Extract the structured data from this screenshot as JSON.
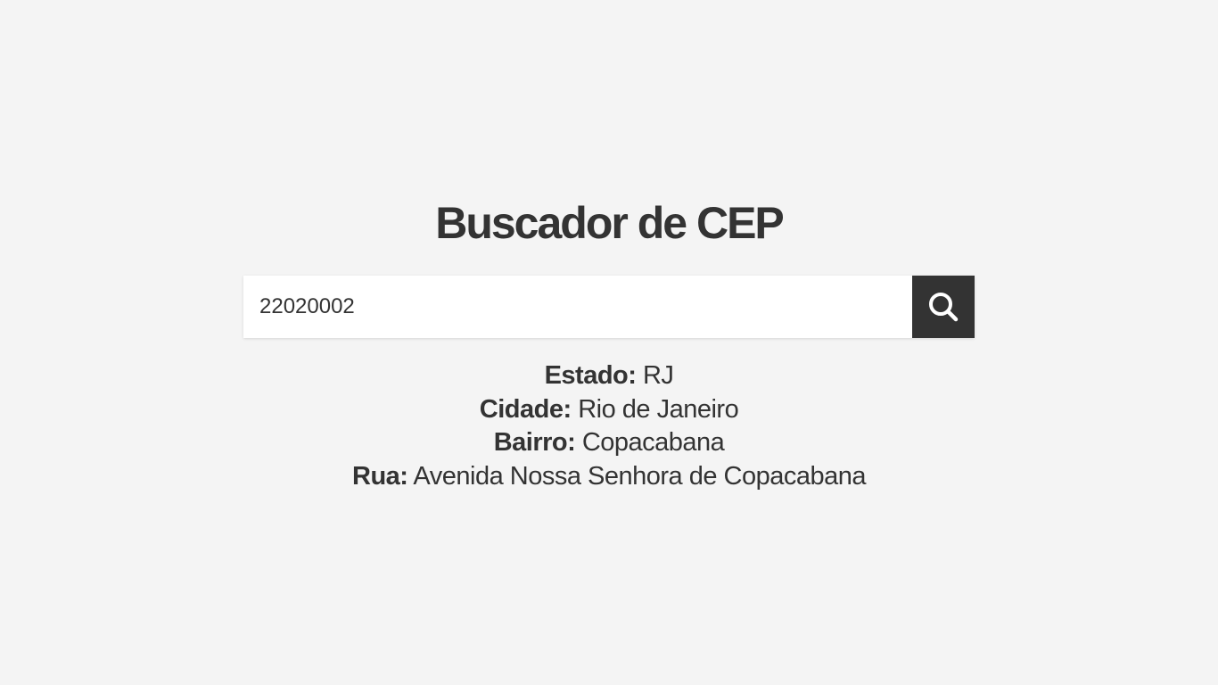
{
  "page": {
    "title": "Buscador de CEP"
  },
  "search": {
    "value": "22020002",
    "button_icon": "search-icon"
  },
  "results": {
    "estado": {
      "label": "Estado:",
      "value": "RJ"
    },
    "cidade": {
      "label": "Cidade:",
      "value": "Rio de Janeiro"
    },
    "bairro": {
      "label": "Bairro:",
      "value": "Copacabana"
    },
    "rua": {
      "label": "Rua:",
      "value": "Avenida Nossa Senhora de Copacabana"
    }
  },
  "colors": {
    "background": "#f4f4f4",
    "text": "#333333",
    "input_background": "#ffffff",
    "button_background": "#333333",
    "icon": "#ffffff"
  }
}
